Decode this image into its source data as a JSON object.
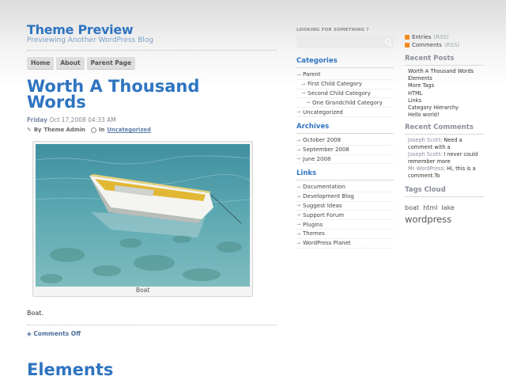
{
  "header": {
    "title": "Theme Preview",
    "description": "Previewing Another WordPress Blog",
    "nav": [
      "Home",
      "About",
      "Parent Page"
    ]
  },
  "post": {
    "title": "Worth A Thousand Words",
    "day": "Friday",
    "date": "Oct 17,2008 04:33 AM",
    "by_prefix": "By",
    "author": "Theme Admin",
    "in_prefix": "In",
    "category": "Uncategorized",
    "caption": "Boat",
    "body": "Boat.",
    "comments_link": "Comments Off"
  },
  "next_post": {
    "title": "Elements"
  },
  "sidebar": {
    "search_label": "LOOKING FOR SOMETHING ?",
    "categories_title": "Categories",
    "categories": [
      {
        "label": "Parent",
        "level": 0
      },
      {
        "label": "First Child Category",
        "level": 1
      },
      {
        "label": "Second Child Category",
        "level": 1
      },
      {
        "label": "One Grandchild Category",
        "level": 2
      },
      {
        "label": "Uncategorized",
        "level": 0
      }
    ],
    "archives_title": "Archives",
    "archives": [
      "October 2008",
      "September 2008",
      "June 2008"
    ],
    "links_title": "Links",
    "links": [
      "Documentation",
      "Development Blog",
      "Suggest Ideas",
      "Support Forum",
      "Plugins",
      "Themes",
      "WordPress Planet"
    ]
  },
  "sidebar2": {
    "feeds": [
      {
        "label": "Entries",
        "tag": "(RSS)"
      },
      {
        "label": "Comments",
        "tag": "(RSS)"
      }
    ],
    "recent_posts_title": "Recent Posts",
    "recent_posts": [
      "Worth A Thousand Words",
      "Elements",
      "More Tags",
      "HTML",
      "Links",
      "Category Hierarchy",
      "Hello world!"
    ],
    "recent_comments_title": "Recent Comments",
    "recent_comments": [
      {
        "author": "Joseph Scott",
        "text": ": Need a comment with a"
      },
      {
        "author": "Joseph Scott",
        "text": ": I never could remember more"
      },
      {
        "author": "Mr WordPress",
        "text": ": Hi, this is a comment.To"
      }
    ],
    "tags_title": "Tags Cloud",
    "tags_small": [
      "boat",
      "html",
      "lake"
    ],
    "tags_large": [
      "wordpress"
    ]
  },
  "colors": {
    "accent": "#2f74c0",
    "muted_title": "#8a8f9b",
    "rss": "#f3891e"
  }
}
